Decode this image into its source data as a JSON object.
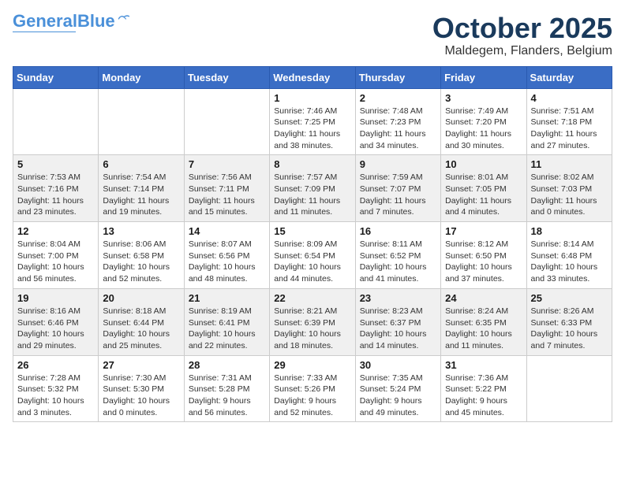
{
  "header": {
    "logo_line1": "General",
    "logo_line2": "Blue",
    "month_title": "October 2025",
    "location": "Maldegem, Flanders, Belgium"
  },
  "weekdays": [
    "Sunday",
    "Monday",
    "Tuesday",
    "Wednesday",
    "Thursday",
    "Friday",
    "Saturday"
  ],
  "weeks": [
    [
      {
        "day": "",
        "info": ""
      },
      {
        "day": "",
        "info": ""
      },
      {
        "day": "",
        "info": ""
      },
      {
        "day": "1",
        "info": "Sunrise: 7:46 AM\nSunset: 7:25 PM\nDaylight: 11 hours\nand 38 minutes."
      },
      {
        "day": "2",
        "info": "Sunrise: 7:48 AM\nSunset: 7:23 PM\nDaylight: 11 hours\nand 34 minutes."
      },
      {
        "day": "3",
        "info": "Sunrise: 7:49 AM\nSunset: 7:20 PM\nDaylight: 11 hours\nand 30 minutes."
      },
      {
        "day": "4",
        "info": "Sunrise: 7:51 AM\nSunset: 7:18 PM\nDaylight: 11 hours\nand 27 minutes."
      }
    ],
    [
      {
        "day": "5",
        "info": "Sunrise: 7:53 AM\nSunset: 7:16 PM\nDaylight: 11 hours\nand 23 minutes."
      },
      {
        "day": "6",
        "info": "Sunrise: 7:54 AM\nSunset: 7:14 PM\nDaylight: 11 hours\nand 19 minutes."
      },
      {
        "day": "7",
        "info": "Sunrise: 7:56 AM\nSunset: 7:11 PM\nDaylight: 11 hours\nand 15 minutes."
      },
      {
        "day": "8",
        "info": "Sunrise: 7:57 AM\nSunset: 7:09 PM\nDaylight: 11 hours\nand 11 minutes."
      },
      {
        "day": "9",
        "info": "Sunrise: 7:59 AM\nSunset: 7:07 PM\nDaylight: 11 hours\nand 7 minutes."
      },
      {
        "day": "10",
        "info": "Sunrise: 8:01 AM\nSunset: 7:05 PM\nDaylight: 11 hours\nand 4 minutes."
      },
      {
        "day": "11",
        "info": "Sunrise: 8:02 AM\nSunset: 7:03 PM\nDaylight: 11 hours\nand 0 minutes."
      }
    ],
    [
      {
        "day": "12",
        "info": "Sunrise: 8:04 AM\nSunset: 7:00 PM\nDaylight: 10 hours\nand 56 minutes."
      },
      {
        "day": "13",
        "info": "Sunrise: 8:06 AM\nSunset: 6:58 PM\nDaylight: 10 hours\nand 52 minutes."
      },
      {
        "day": "14",
        "info": "Sunrise: 8:07 AM\nSunset: 6:56 PM\nDaylight: 10 hours\nand 48 minutes."
      },
      {
        "day": "15",
        "info": "Sunrise: 8:09 AM\nSunset: 6:54 PM\nDaylight: 10 hours\nand 44 minutes."
      },
      {
        "day": "16",
        "info": "Sunrise: 8:11 AM\nSunset: 6:52 PM\nDaylight: 10 hours\nand 41 minutes."
      },
      {
        "day": "17",
        "info": "Sunrise: 8:12 AM\nSunset: 6:50 PM\nDaylight: 10 hours\nand 37 minutes."
      },
      {
        "day": "18",
        "info": "Sunrise: 8:14 AM\nSunset: 6:48 PM\nDaylight: 10 hours\nand 33 minutes."
      }
    ],
    [
      {
        "day": "19",
        "info": "Sunrise: 8:16 AM\nSunset: 6:46 PM\nDaylight: 10 hours\nand 29 minutes."
      },
      {
        "day": "20",
        "info": "Sunrise: 8:18 AM\nSunset: 6:44 PM\nDaylight: 10 hours\nand 25 minutes."
      },
      {
        "day": "21",
        "info": "Sunrise: 8:19 AM\nSunset: 6:41 PM\nDaylight: 10 hours\nand 22 minutes."
      },
      {
        "day": "22",
        "info": "Sunrise: 8:21 AM\nSunset: 6:39 PM\nDaylight: 10 hours\nand 18 minutes."
      },
      {
        "day": "23",
        "info": "Sunrise: 8:23 AM\nSunset: 6:37 PM\nDaylight: 10 hours\nand 14 minutes."
      },
      {
        "day": "24",
        "info": "Sunrise: 8:24 AM\nSunset: 6:35 PM\nDaylight: 10 hours\nand 11 minutes."
      },
      {
        "day": "25",
        "info": "Sunrise: 8:26 AM\nSunset: 6:33 PM\nDaylight: 10 hours\nand 7 minutes."
      }
    ],
    [
      {
        "day": "26",
        "info": "Sunrise: 7:28 AM\nSunset: 5:32 PM\nDaylight: 10 hours\nand 3 minutes."
      },
      {
        "day": "27",
        "info": "Sunrise: 7:30 AM\nSunset: 5:30 PM\nDaylight: 10 hours\nand 0 minutes."
      },
      {
        "day": "28",
        "info": "Sunrise: 7:31 AM\nSunset: 5:28 PM\nDaylight: 9 hours\nand 56 minutes."
      },
      {
        "day": "29",
        "info": "Sunrise: 7:33 AM\nSunset: 5:26 PM\nDaylight: 9 hours\nand 52 minutes."
      },
      {
        "day": "30",
        "info": "Sunrise: 7:35 AM\nSunset: 5:24 PM\nDaylight: 9 hours\nand 49 minutes."
      },
      {
        "day": "31",
        "info": "Sunrise: 7:36 AM\nSunset: 5:22 PM\nDaylight: 9 hours\nand 45 minutes."
      },
      {
        "day": "",
        "info": ""
      }
    ]
  ]
}
